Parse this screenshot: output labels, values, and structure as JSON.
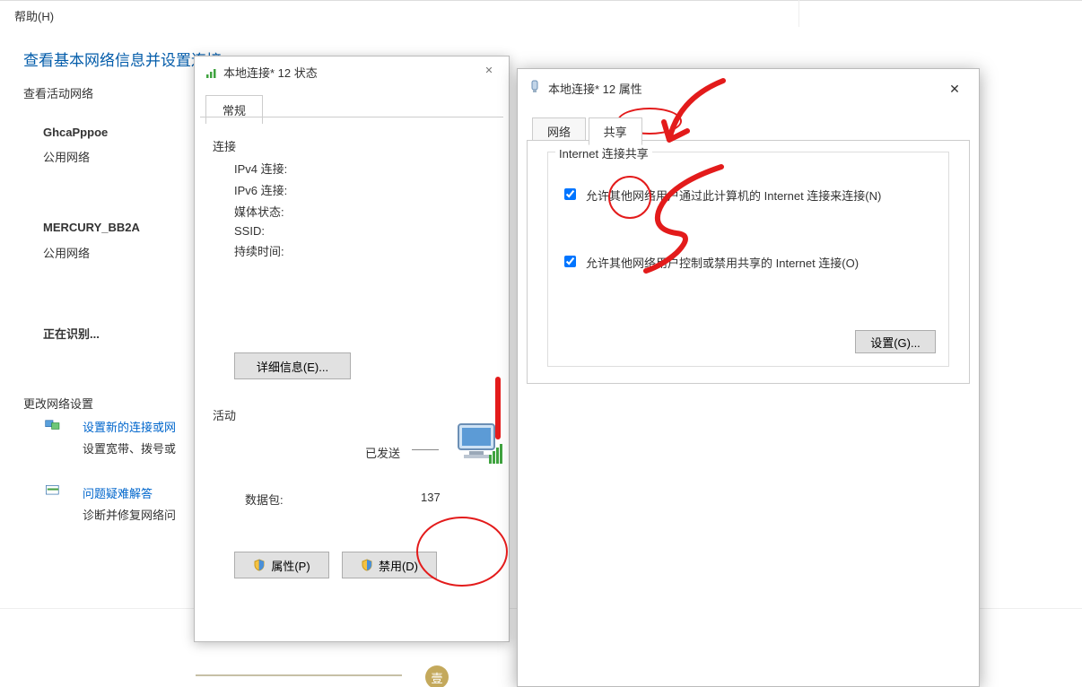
{
  "bg": {
    "help": "帮助(H)",
    "title": "查看基本网络信息并设置连接",
    "viewActive": "查看活动网络",
    "net1": {
      "name": "GhcaPppoe",
      "type": "公用网络"
    },
    "net2": {
      "name": "MERCURY_BB2A",
      "type": "公用网络"
    },
    "identifying": "正在识别...",
    "changeSettings": "更改网络设置",
    "setupLink": "设置新的连接或网",
    "setupDesc": "设置宽带、拨号或",
    "troubleLink": "问题疑难解答",
    "troubleDesc": "诊断并修复网络问",
    "yi": "壹"
  },
  "statusDialog": {
    "title": "本地连接* 12 状态",
    "tabGeneral": "常规",
    "connectionHeader": "连接",
    "rows": {
      "ipv4": "IPv4 连接:",
      "ipv6": "IPv6 连接:",
      "media": "媒体状态:",
      "ssid": "SSID:",
      "duration": "持续时间:"
    },
    "detailsBtn": "详细信息(E)...",
    "activityHeader": "活动",
    "sent": "已发送",
    "packetsLabel": "数据包:",
    "packetsValue": "137",
    "propertiesBtn": "属性(P)",
    "disableBtn": "禁用(D)"
  },
  "propDialog": {
    "title": "本地连接* 12 属性",
    "tabNetwork": "网络",
    "tabSharing": "共享",
    "fsLegend": "Internet 连接共享",
    "cb1": "允许其他网络用户通过此计算机的 Internet 连接来连接(N)",
    "cb2": "允许其他网络用户控制或禁用共享的 Internet 连接(O)",
    "settingsBtn": "设置(G)..."
  }
}
